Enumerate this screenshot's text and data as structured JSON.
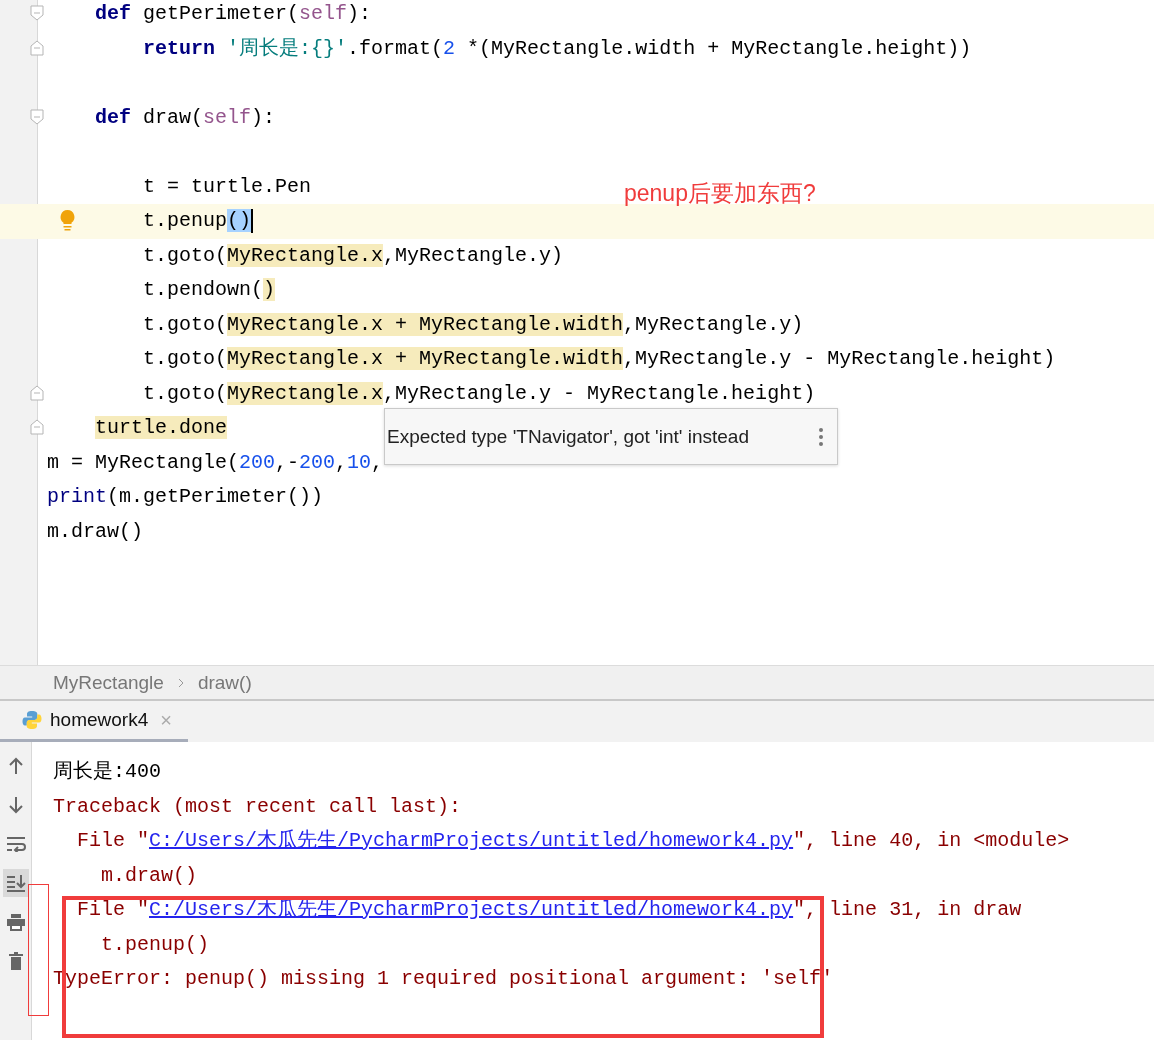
{
  "editor": {
    "lines": [
      {
        "current": false,
        "kind": "fold-start",
        "segments": [
          {
            "kind": "keyword",
            "text": "    def"
          },
          {
            "kind": "plain",
            "text": " getPerimeter("
          },
          {
            "kind": "self",
            "text": "self"
          },
          {
            "kind": "plain",
            "text": "):"
          }
        ]
      },
      {
        "current": false,
        "kind": "fold-end",
        "segments": [
          {
            "kind": "keyword",
            "text": "        return"
          },
          {
            "kind": "string",
            "text": " '周长是:{}'"
          },
          {
            "kind": "plain",
            "text": ".format("
          },
          {
            "kind": "number",
            "text": "2"
          },
          {
            "kind": "plain",
            "text": " *(MyRectangle.width + MyRectangle.height))"
          }
        ]
      },
      {
        "current": false,
        "kind": "plain"
      },
      {
        "current": false,
        "kind": "fold-start",
        "segments": [
          {
            "kind": "keyword",
            "text": "    def"
          },
          {
            "kind": "plain",
            "text": " draw("
          },
          {
            "kind": "self",
            "text": "self"
          },
          {
            "kind": "plain",
            "text": "):"
          }
        ]
      },
      {
        "current": false,
        "kind": "plain"
      },
      {
        "current": false,
        "kind": "plain",
        "segments": [
          {
            "kind": "plain",
            "text": "        t = turtle.Pen"
          }
        ]
      },
      {
        "current": true,
        "kind": "bulb",
        "caret": true,
        "segments": [
          {
            "kind": "plain",
            "text": "        t.penup"
          },
          {
            "kind": "selected",
            "text": "()"
          }
        ]
      },
      {
        "current": false,
        "kind": "plain",
        "segments": [
          {
            "kind": "plain",
            "text": "        t.goto("
          },
          {
            "kind": "highlight",
            "text": "MyRectangle.x"
          },
          {
            "kind": "plain",
            "text": ",MyRectangle.y)"
          }
        ]
      },
      {
        "current": false,
        "kind": "plain",
        "segments": [
          {
            "kind": "plain",
            "text": "        t.pendown("
          },
          {
            "kind": "highlight",
            "text": ")"
          }
        ]
      },
      {
        "current": false,
        "kind": "plain",
        "segments": [
          {
            "kind": "plain",
            "text": "        t.goto("
          },
          {
            "kind": "highlight",
            "text": "MyRectangle.x + MyRectangle.width"
          },
          {
            "kind": "plain",
            "text": ",MyRectangle.y)"
          }
        ]
      },
      {
        "current": false,
        "kind": "plain",
        "segments": [
          {
            "kind": "plain",
            "text": "        t.goto("
          },
          {
            "kind": "highlight",
            "text": "MyRectangle.x + MyRectangle.width"
          },
          {
            "kind": "plain",
            "text": ",MyRectangle.y - MyRectangle.height)"
          }
        ]
      },
      {
        "current": false,
        "kind": "fold-end",
        "segments": [
          {
            "kind": "plain",
            "text": "        t.goto("
          },
          {
            "kind": "highlight",
            "text": "MyRectangle.x"
          },
          {
            "kind": "plain",
            "text": ",MyRectangle.y - MyRectangle.height)"
          }
        ]
      },
      {
        "current": false,
        "kind": "fold-end",
        "segments": [
          {
            "kind": "highlight",
            "text": "    turtle.done"
          }
        ]
      },
      {
        "current": false,
        "kind": "plain",
        "segments": [
          {
            "kind": "plain",
            "text": "m = MyRectangle("
          },
          {
            "kind": "number",
            "text": "200"
          },
          {
            "kind": "plain",
            "text": ",-"
          },
          {
            "kind": "number",
            "text": "200"
          },
          {
            "kind": "plain",
            "text": ","
          },
          {
            "kind": "number",
            "text": "10"
          },
          {
            "kind": "plain",
            "text": ","
          }
        ]
      },
      {
        "current": false,
        "kind": "plain",
        "segments": [
          {
            "kind": "builtin",
            "text": "print"
          },
          {
            "kind": "plain",
            "text": "(m.getPerimeter())"
          }
        ]
      },
      {
        "current": false,
        "kind": "plain",
        "segments": [
          {
            "kind": "plain",
            "text": "m.draw()"
          }
        ]
      }
    ],
    "annotation": "penup后要加东西?",
    "tooltip": "Expected type 'TNavigator', got 'int' instead"
  },
  "breadcrumb": [
    "MyRectangle",
    "draw()"
  ],
  "run_tab": {
    "label": "homework4",
    "close": "×",
    "selected": true
  },
  "console": {
    "tools": [
      {
        "kind": "up",
        "on": false
      },
      {
        "kind": "down",
        "on": false
      },
      {
        "kind": "wrap",
        "on": false
      },
      {
        "kind": "scroll-end",
        "on": true
      },
      {
        "kind": "print",
        "on": false
      },
      {
        "kind": "trash",
        "on": false
      }
    ],
    "lines": [
      {
        "segments": [
          {
            "kind": "output",
            "text": "周长是:400"
          }
        ]
      },
      {
        "segments": [
          {
            "kind": "error",
            "text": "Traceback (most recent call last):"
          }
        ]
      },
      {
        "segments": [
          {
            "kind": "error",
            "text": "  File \""
          },
          {
            "kind": "link",
            "text": "C:/Users/木瓜先生/PycharmProjects/untitled/homework4.py"
          },
          {
            "kind": "error",
            "text": "\", line 40, in <module>"
          }
        ]
      },
      {
        "segments": [
          {
            "kind": "error",
            "text": "    m.draw()"
          }
        ]
      },
      {
        "segments": [
          {
            "kind": "error",
            "text": "  File \""
          },
          {
            "kind": "link",
            "text": "C:/Users/木瓜先生/PycharmProjects/untitled/homework4.py"
          },
          {
            "kind": "error",
            "text": "\", line 31, in draw"
          }
        ]
      },
      {
        "segments": [
          {
            "kind": "error",
            "text": "    t.penup()"
          }
        ]
      },
      {
        "segments": [
          {
            "kind": "error",
            "text": "TypeError: penup() missing 1 required positional argument: 'self'"
          }
        ]
      }
    ]
  }
}
